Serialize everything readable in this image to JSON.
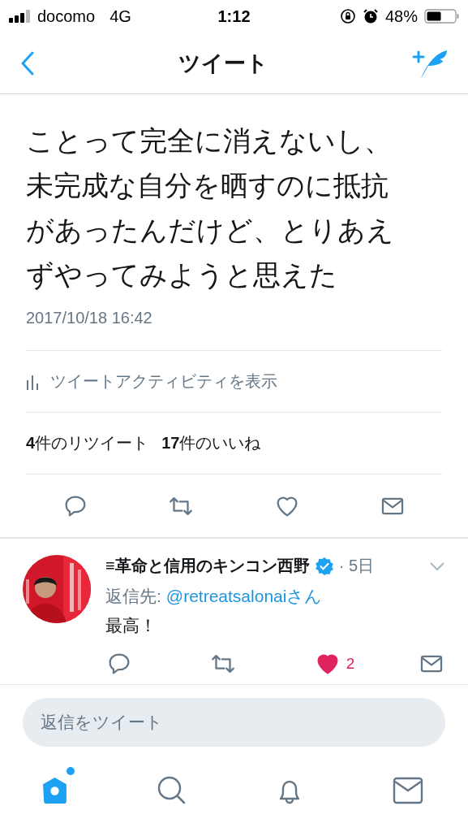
{
  "status_bar": {
    "carrier": "docomo",
    "network": "4G",
    "time": "1:12",
    "battery": "48%"
  },
  "header": {
    "title": "ツイート"
  },
  "tweet": {
    "text": "ことって完全に消えないし、未完成な自分を晒すのに抵抗があったんだけど、とりあえずやってみようと思えた",
    "timestamp": "2017/10/18 16:42",
    "activity_link": "ツイートアクティビティを表示",
    "retweets": "**4**件のリツイート",
    "likes": "**17**件のいいね",
    "actions": [
      {
        "kind": "reply"
      },
      {
        "kind": "retweet"
      },
      {
        "kind": "like",
        "liked": false
      },
      {
        "kind": "message"
      }
    ]
  },
  "reply": {
    "author": "≡革命と信用のキンコン西野",
    "verified": true,
    "time": "· 5日",
    "reply_to_label": "返信先:",
    "reply_to_handle": "@retreatsalonaiさん",
    "text": "最高！",
    "actions": [
      {
        "kind": "reply"
      },
      {
        "kind": "retweet"
      },
      {
        "kind": "like",
        "liked": true,
        "count": "2"
      },
      {
        "kind": "message"
      }
    ]
  },
  "reply_box": {
    "placeholder": "返信をツイート"
  },
  "tabs": [
    {
      "kind": "home",
      "selected": true,
      "unread": true
    },
    {
      "kind": "search",
      "selected": false
    },
    {
      "kind": "notifications",
      "selected": false
    },
    {
      "kind": "messages",
      "selected": false
    }
  ]
}
